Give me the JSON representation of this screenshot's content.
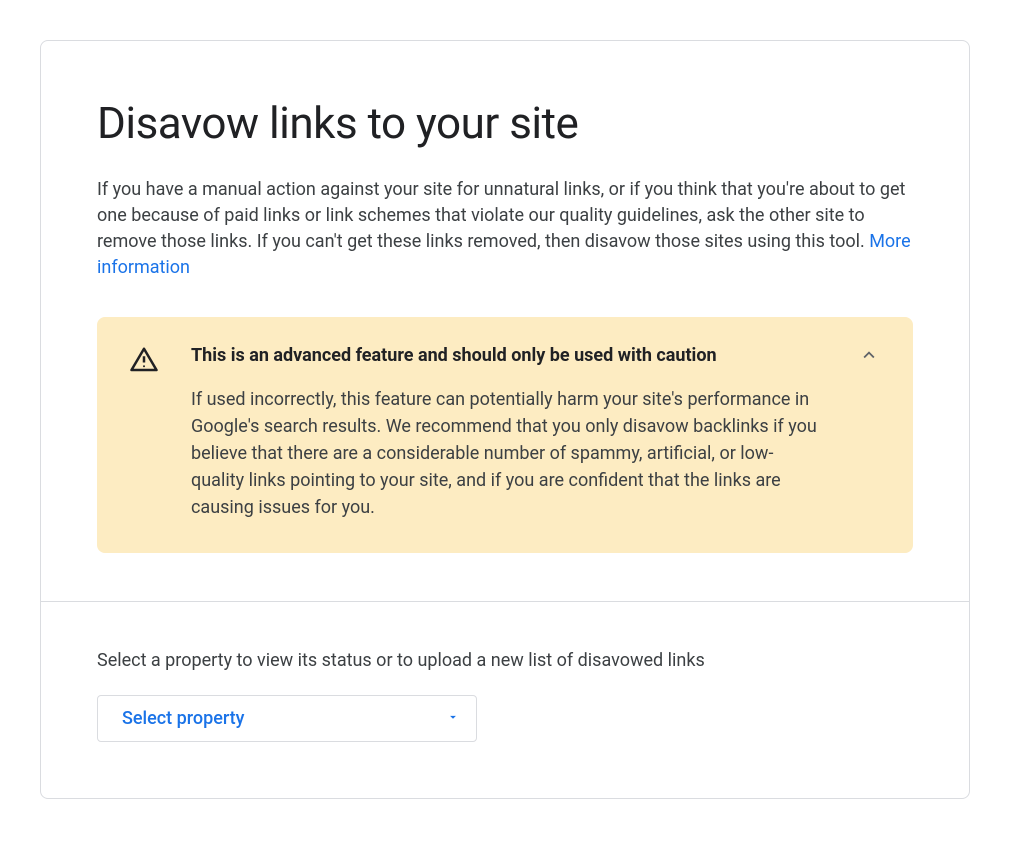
{
  "header": {
    "title": "Disavow links to your site",
    "description": "If you have a manual action against your site for unnatural links, or if you think that you're about to get one because of paid links or link schemes that violate our quality guidelines, ask the other site to remove those links. If you can't get these links removed, then disavow those sites using this tool. ",
    "more_info_label": "More information"
  },
  "warning": {
    "title": "This is an advanced feature and should only be used with caution",
    "body": "If used incorrectly, this feature can potentially harm your site's performance in Google's search results. We recommend that you only disavow backlinks if you believe that there are a considerable number of spammy, artificial, or low-quality links pointing to your site, and if you are confident that the links are causing issues for you."
  },
  "property_selector": {
    "label": "Select a property to view its status or to upload a new list of disavowed links",
    "placeholder": "Select property"
  }
}
